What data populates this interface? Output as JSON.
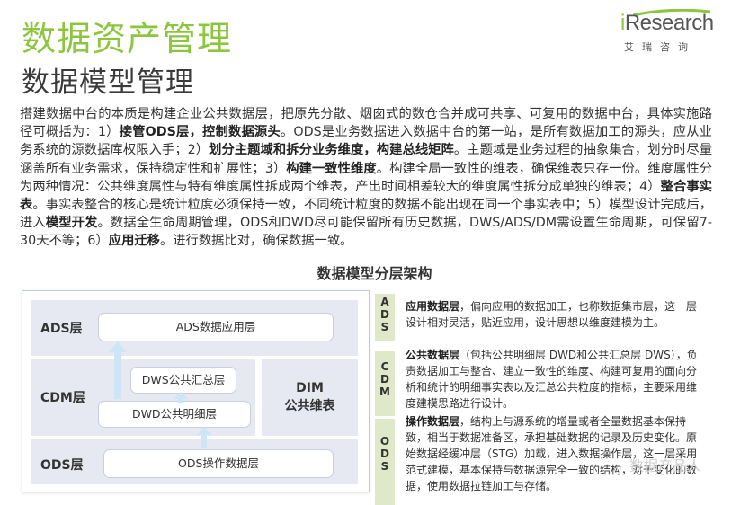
{
  "header": {
    "title": "数据资产管理",
    "subtitle": "数据模型管理"
  },
  "logo": {
    "brand_prefix": "i",
    "brand_rest": "Research",
    "sub": "艾瑞咨询",
    "accent_color": "#8cc63e"
  },
  "paragraph": [
    {
      "text": "搭建数据中台的本质是构建企业公共数据层，把原先分散、烟囱式的数仓合并成可共享、可复用的数据中台，具体实施路径可概括为：1）",
      "bold": false
    },
    {
      "text": "接管ODS层，控制数据源头",
      "bold": true
    },
    {
      "text": "。ODS是业务数据进入数据中台的第一站，是所有数据加工的源头，应从业务系统的源数据库权限入手；2）",
      "bold": false
    },
    {
      "text": "划分主题域和拆分业务维度，构建总线矩阵",
      "bold": true
    },
    {
      "text": "。主题域是业务过程的抽象集合，划分时尽量涵盖所有业务需求，保持稳定性和扩展性；3）",
      "bold": false
    },
    {
      "text": "构建一致性维度",
      "bold": true
    },
    {
      "text": "。构建全局一致性的维表，确保维表只存一份。维度属性分为两种情况：公共维度属性与特有维度属性拆成两个维表，产出时间相差较大的维度属性拆分成单独的维表；4）",
      "bold": false
    },
    {
      "text": "整合事实表",
      "bold": true
    },
    {
      "text": "。事实表整合的核心是统计粒度必须保持一致，不同统计粒度的数据不能出现在同一个事实表中；5）模型设计完成后，进入",
      "bold": false
    },
    {
      "text": "模型开发",
      "bold": true
    },
    {
      "text": "。数据全生命周期管理，ODS和DWD尽可能保留所有历史数据，DWS/ADS/DM需设置生命周期，可保留7-30天不等；6）",
      "bold": false
    },
    {
      "text": "应用迁移",
      "bold": true
    },
    {
      "text": "。进行数据比对，确保数据一致。",
      "bold": false
    }
  ],
  "diagram": {
    "title": "数据模型分层架构",
    "layers": {
      "ads": "ADS层",
      "cdm": "CDM层",
      "ods": "ODS层"
    },
    "boxes": {
      "ads_app": "ADS数据应用层",
      "dws": "DWS公共汇总层",
      "dwd": "DWD公共明细层",
      "ods_op": "ODS操作数据层"
    },
    "dim": [
      "DIM",
      "公共维表"
    ]
  },
  "legend": [
    {
      "tag": [
        "A",
        "D",
        "S"
      ],
      "heading": "应用数据层",
      "text": "，偏向应用的数据加工，也称数据集市层，这一层设计相对灵活，贴近应用，设计思想以维度建模为主。"
    },
    {
      "tag": [
        "C",
        "D",
        "M"
      ],
      "heading": "公共数据层",
      "text": "（包括公共明细层 DWD和公共汇总层 DWS），负责数据加工与整合、建立一致性的维度、构建可复用的面向分析和统计的明细事实表以及汇总公共粒度的指标，主要采用维度建模思路进行设计。"
    },
    {
      "tag": [
        "O",
        "D",
        "S"
      ],
      "heading": "操作数据层",
      "text": "，结构上与源系统的增量或者全量数据基本保持一致，相当于数据准备区，承担基础数据的记录及历史变化。原始数据经缓冲层（STG）加载，进入数据操作层，这一层采用范式建模，基本保持与数据源完全一致的结构，对于变化的数据，使用数据拉链加工与存储。"
    }
  ],
  "watermark": "数据产品人",
  "colors": {
    "title_green": "#8cc63e",
    "band_gray": "#e6e9f1",
    "tag_green": "#dfe8c8",
    "arrow_blue": "#cde6f5"
  }
}
